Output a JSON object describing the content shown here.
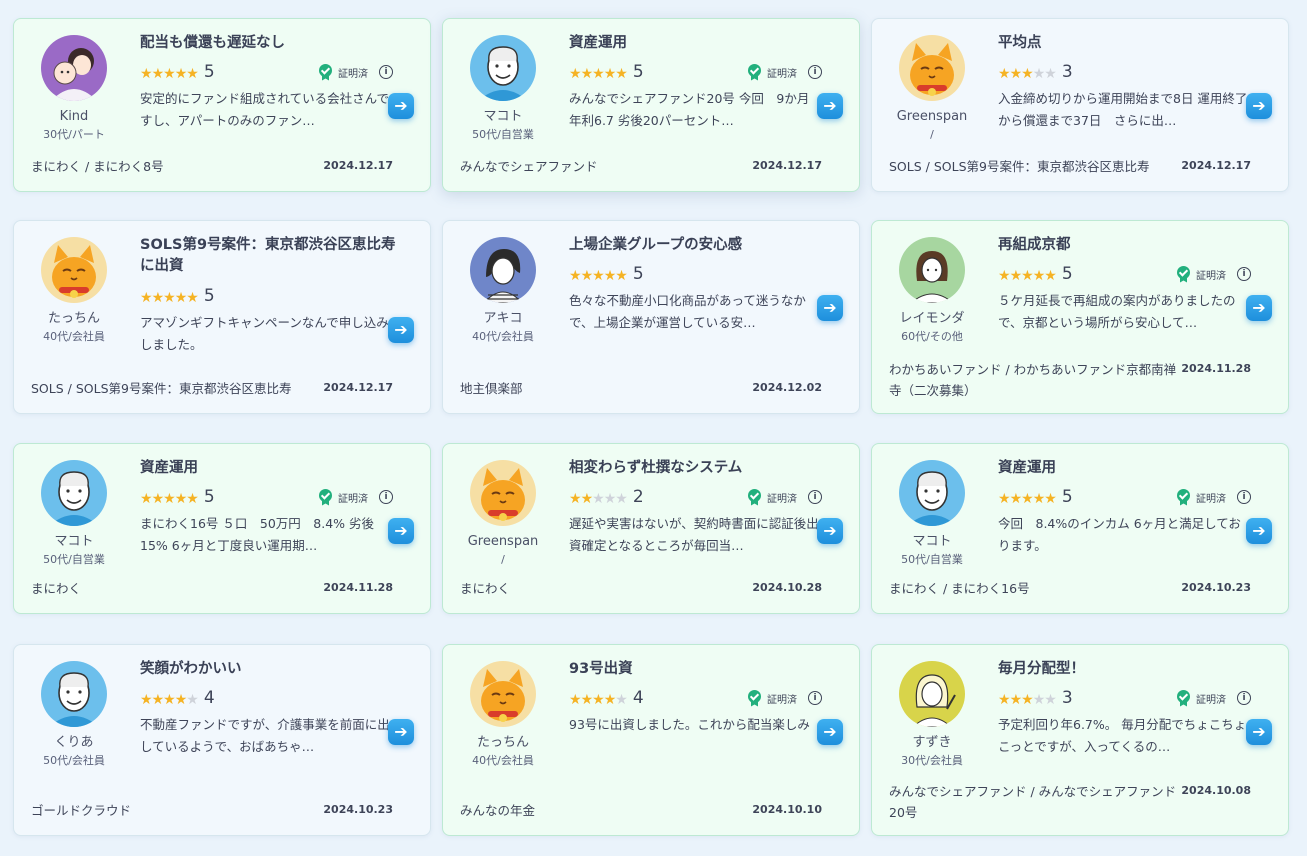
{
  "colors": {
    "verified_bg": "#effdf4",
    "plain_bg": "#f2f8fd",
    "star": "#f5b324",
    "badge": "#22b07d",
    "arrow": "#1e8fdc"
  },
  "cert_label": "証明済",
  "arrow_icon": "arrow-right-icon",
  "reviews": [
    {
      "title": "配当も償還も遅延なし",
      "nick": "Kind",
      "attr": "30代/パート",
      "avatar": "mother-child",
      "rating": 5,
      "score": "5",
      "verified": true,
      "text": "安定的にファンド組成されている会社さんですし、アパートのみのファン…",
      "fund": "まにわく / まにわく8号",
      "date": "2024.12.17"
    },
    {
      "title": "資産運用",
      "nick": "マコト",
      "attr": "50代/自営業",
      "avatar": "old-man",
      "rating": 5,
      "score": "5",
      "verified": true,
      "text": "みんなでシェアファンド20号 今回　9か月 年利6.7 劣後20パーセント…",
      "fund": "みんなでシェアファンド",
      "date": "2024.12.17"
    },
    {
      "title": "平均点",
      "nick": "Greenspan",
      "attr": "/",
      "avatar": "cat",
      "rating": 3,
      "score": "3",
      "verified": false,
      "text": "入金締め切りから運用開始まで8日 運用終了から償還まで37日　さらに出…",
      "fund": "SOLS / SOLS第9号案件：東京都渋谷区恵比寿",
      "date": "2024.12.17"
    },
    {
      "title": "SOLS第9号案件：東京都渋谷区恵比寿に出資",
      "nick": "たっちん",
      "attr": "40代/会社員",
      "avatar": "cat",
      "rating": 5,
      "score": "5",
      "verified": false,
      "text": "アマゾンギフトキャンペーンなんで申し込みしました。",
      "fund": "SOLS / SOLS第9号案件：東京都渋谷区恵比寿",
      "date": "2024.12.17"
    },
    {
      "title": "上場企業グループの安心感",
      "nick": "アキコ",
      "attr": "40代/会社員",
      "avatar": "woman-short",
      "rating": 5,
      "score": "5",
      "verified": false,
      "text": "色々な不動産小口化商品があって迷うなかで、上場企業が運営している安…",
      "fund": "地主倶楽部",
      "date": "2024.12.02"
    },
    {
      "title": "再組成京都",
      "nick": "レイモンダ",
      "attr": "60代/その他",
      "avatar": "woman-bob",
      "rating": 5,
      "score": "5",
      "verified": true,
      "text": "５ケ月延長で再組成の案内がありましたので、京都という場所がら安心して…",
      "fund": "わかちあいファンド / わかちあいファンド京都南禅寺（二次募集）",
      "date": "2024.11.28"
    },
    {
      "title": "資産運用",
      "nick": "マコト",
      "attr": "50代/自営業",
      "avatar": "old-man",
      "rating": 5,
      "score": "5",
      "verified": true,
      "text": "まにわく16号 ５口　50万円　8.4% 劣後15%  6ヶ月と丁度良い運用期…",
      "fund": "まにわく",
      "date": "2024.11.28"
    },
    {
      "title": "相変わらず杜撰なシステム",
      "nick": "Greenspan",
      "attr": "/",
      "avatar": "cat",
      "rating": 2,
      "score": "2",
      "verified": true,
      "text": "遅延や実害はないが、契約時書面に認証後出資確定となるところが毎回当…",
      "fund": "まにわく",
      "date": "2024.10.28"
    },
    {
      "title": "資産運用",
      "nick": "マコト",
      "attr": "50代/自営業",
      "avatar": "old-man",
      "rating": 5,
      "score": "5",
      "verified": true,
      "text": "今回　8.4%のインカム 6ヶ月と満足しております。",
      "fund": "まにわく / まにわく16号",
      "date": "2024.10.23"
    },
    {
      "title": "笑顔がわかいい",
      "nick": "くりあ",
      "attr": "50代/会社員",
      "avatar": "old-man",
      "rating": 4,
      "score": "4",
      "verified": false,
      "text": "不動産ファンドですが、介護事業を前面に出しているようで、おばあちゃ…",
      "fund": "ゴールドクラウド",
      "date": "2024.10.23"
    },
    {
      "title": "93号出資",
      "nick": "たっちん",
      "attr": "40代/会社員",
      "avatar": "cat",
      "rating": 4,
      "score": "4",
      "verified": true,
      "text": "93号に出資しました。これから配当楽しみ",
      "fund": "みんなの年金",
      "date": "2024.10.10"
    },
    {
      "title": "毎月分配型！",
      "nick": "すずき",
      "attr": "30代/会社員",
      "avatar": "woman-point",
      "rating": 3,
      "score": "3",
      "verified": true,
      "text": "予定利回り年6.7%。 毎月分配でちょこちょこっとですが、入ってくるの…",
      "fund": "みんなでシェアファンド / みんなでシェアファンド20号",
      "date": "2024.10.08"
    }
  ]
}
